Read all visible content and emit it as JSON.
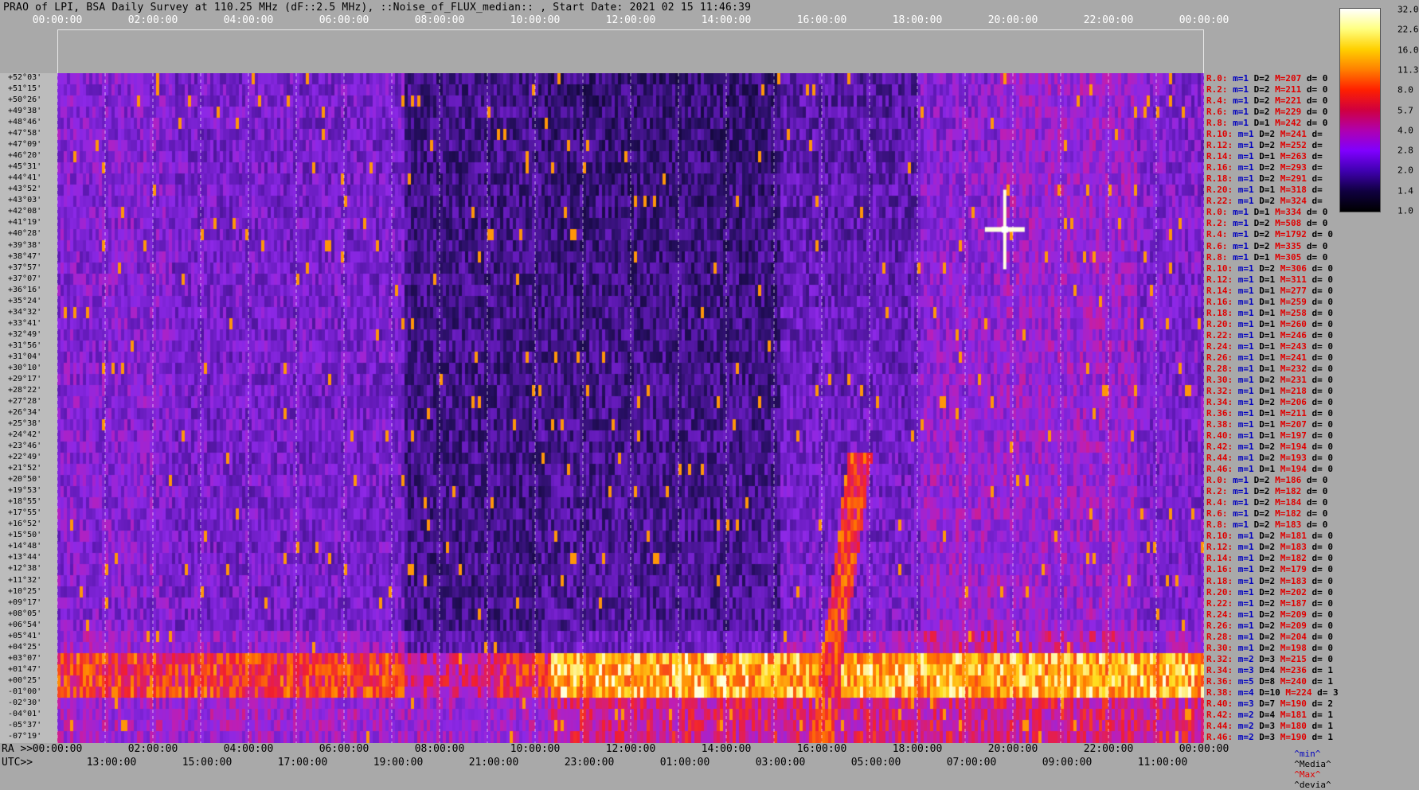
{
  "title": "PRAO of LPI, BSA Daily Survey at 110.25 MHz (dF::2.5 MHz), ::Noise_of_FLUX_median:: , Start Date: 2021 02 15 11:46:39",
  "top_ticks": [
    "00:00:00",
    "02:00:00",
    "04:00:00",
    "06:00:00",
    "08:00:00",
    "10:00:00",
    "12:00:00",
    "14:00:00",
    "16:00:00",
    "18:00:00",
    "20:00:00",
    "22:00:00",
    "00:00:00"
  ],
  "bottom_ra_prefix": "RA >>",
  "bottom_ra_ticks": [
    "00:00:00",
    "02:00:00",
    "04:00:00",
    "06:00:00",
    "08:00:00",
    "10:00:00",
    "12:00:00",
    "14:00:00",
    "16:00:00",
    "18:00:00",
    "20:00:00",
    "22:00:00",
    "00:00:00"
  ],
  "bottom_utc_prefix": "UTC>>",
  "bottom_utc_ticks": [
    "13:00:00",
    "15:00:00",
    "17:00:00",
    "19:00:00",
    "21:00:00",
    "23:00:00",
    "01:00:00",
    "03:00:00",
    "05:00:00",
    "07:00:00",
    "09:00:00",
    "11:00:00"
  ],
  "dec_labels": [
    "+52°03'",
    "+51°15'",
    "+50°26'",
    "+49°38'",
    "+48°46'",
    "+47°58'",
    "+47°09'",
    "+46°20'",
    "+45°31'",
    "+44°41'",
    "+43°52'",
    "+43°03'",
    "+42°08'",
    "+41°19'",
    "+40°28'",
    "+39°38'",
    "+38°47'",
    "+37°57'",
    "+37°07'",
    "+36°16'",
    "+35°24'",
    "+34°32'",
    "+33°41'",
    "+32°49'",
    "+31°56'",
    "+31°04'",
    "+30°10'",
    "+29°17'",
    "+28°22'",
    "+27°28'",
    "+26°34'",
    "+25°38'",
    "+24°42'",
    "+23°46'",
    "+22°49'",
    "+21°52'",
    "+20°50'",
    "+19°53'",
    "+18°55'",
    "+17°55'",
    "+16°52'",
    "+15°50'",
    "+14°48'",
    "+13°44'",
    "+12°38'",
    "+11°32'",
    "+10°25'",
    "+09°17'",
    "+08°05'",
    "+06°54'",
    "+05°41'",
    "+04°25'",
    "+03°07'",
    "+01°47'",
    "+00°25'",
    "-01°00'",
    "-02°30'",
    "-04°01'",
    "-05°37'",
    "-07°19'"
  ],
  "stats_rows": [
    {
      "r": "R.0:",
      "m": "m=1",
      "D": "D=2",
      "M": "M=207",
      "d": "d= 0"
    },
    {
      "r": "R.2:",
      "m": "m=1",
      "D": "D=2",
      "M": "M=211",
      "d": "d= 0"
    },
    {
      "r": "R.4:",
      "m": "m=1",
      "D": "D=2",
      "M": "M=221",
      "d": "d= 0"
    },
    {
      "r": "R.6:",
      "m": "m=1",
      "D": "D=2",
      "M": "M=229",
      "d": "d= 0"
    },
    {
      "r": "R.8:",
      "m": "m=1",
      "D": "D=1",
      "M": "M=242",
      "d": "d= 0"
    },
    {
      "r": "R.10:",
      "m": "m=1",
      "D": "D=2",
      "M": "M=241",
      "d": "d="
    },
    {
      "r": "R.12:",
      "m": "m=1",
      "D": "D=2",
      "M": "M=252",
      "d": "d="
    },
    {
      "r": "R.14:",
      "m": "m=1",
      "D": "D=1",
      "M": "M=263",
      "d": "d="
    },
    {
      "r": "R.16:",
      "m": "m=1",
      "D": "D=2",
      "M": "M=293",
      "d": "d="
    },
    {
      "r": "R.18:",
      "m": "m=1",
      "D": "D=2",
      "M": "M=291",
      "d": "d="
    },
    {
      "r": "R.20:",
      "m": "m=1",
      "D": "D=1",
      "M": "M=318",
      "d": "d="
    },
    {
      "r": "R.22:",
      "m": "m=1",
      "D": "D=2",
      "M": "M=324",
      "d": "d="
    },
    {
      "r": "R.0:",
      "m": "m=1",
      "D": "D=1",
      "M": "M=334",
      "d": "d= 0"
    },
    {
      "r": "R.2:",
      "m": "m=1",
      "D": "D=2",
      "M": "M=508",
      "d": "d= 0"
    },
    {
      "r": "R.4:",
      "m": "m=1",
      "D": "D=2",
      "M": "M=1792",
      "d": "d= 0"
    },
    {
      "r": "R.6:",
      "m": "m=1",
      "D": "D=2",
      "M": "M=335",
      "d": "d= 0"
    },
    {
      "r": "R.8:",
      "m": "m=1",
      "D": "D=1",
      "M": "M=305",
      "d": "d= 0"
    },
    {
      "r": "R.10:",
      "m": "m=1",
      "D": "D=2",
      "M": "M=306",
      "d": "d= 0"
    },
    {
      "r": "R.12:",
      "m": "m=1",
      "D": "D=1",
      "M": "M=311",
      "d": "d= 0"
    },
    {
      "r": "R.14:",
      "m": "m=1",
      "D": "D=1",
      "M": "M=277",
      "d": "d= 0"
    },
    {
      "r": "R.16:",
      "m": "m=1",
      "D": "D=1",
      "M": "M=259",
      "d": "d= 0"
    },
    {
      "r": "R.18:",
      "m": "m=1",
      "D": "D=1",
      "M": "M=258",
      "d": "d= 0"
    },
    {
      "r": "R.20:",
      "m": "m=1",
      "D": "D=1",
      "M": "M=260",
      "d": "d= 0"
    },
    {
      "r": "R.22:",
      "m": "m=1",
      "D": "D=1",
      "M": "M=246",
      "d": "d= 0"
    },
    {
      "r": "R.24:",
      "m": "m=1",
      "D": "D=1",
      "M": "M=243",
      "d": "d= 0"
    },
    {
      "r": "R.26:",
      "m": "m=1",
      "D": "D=1",
      "M": "M=241",
      "d": "d= 0"
    },
    {
      "r": "R.28:",
      "m": "m=1",
      "D": "D=1",
      "M": "M=232",
      "d": "d= 0"
    },
    {
      "r": "R.30:",
      "m": "m=1",
      "D": "D=2",
      "M": "M=231",
      "d": "d= 0"
    },
    {
      "r": "R.32:",
      "m": "m=1",
      "D": "D=1",
      "M": "M=218",
      "d": "d= 0"
    },
    {
      "r": "R.34:",
      "m": "m=1",
      "D": "D=2",
      "M": "M=206",
      "d": "d= 0"
    },
    {
      "r": "R.36:",
      "m": "m=1",
      "D": "D=1",
      "M": "M=211",
      "d": "d= 0"
    },
    {
      "r": "R.38:",
      "m": "m=1",
      "D": "D=1",
      "M": "M=207",
      "d": "d= 0"
    },
    {
      "r": "R.40:",
      "m": "m=1",
      "D": "D=1",
      "M": "M=197",
      "d": "d= 0"
    },
    {
      "r": "R.42:",
      "m": "m=1",
      "D": "D=2",
      "M": "M=194",
      "d": "d= 0"
    },
    {
      "r": "R.44:",
      "m": "m=1",
      "D": "D=2",
      "M": "M=193",
      "d": "d= 0"
    },
    {
      "r": "R.46:",
      "m": "m=1",
      "D": "D=1",
      "M": "M=194",
      "d": "d= 0"
    },
    {
      "r": "R.0:",
      "m": "m=1",
      "D": "D=2",
      "M": "M=186",
      "d": "d= 0"
    },
    {
      "r": "R.2:",
      "m": "m=1",
      "D": "D=2",
      "M": "M=182",
      "d": "d= 0"
    },
    {
      "r": "R.4:",
      "m": "m=1",
      "D": "D=2",
      "M": "M=184",
      "d": "d= 0"
    },
    {
      "r": "R.6:",
      "m": "m=1",
      "D": "D=2",
      "M": "M=182",
      "d": "d= 0"
    },
    {
      "r": "R.8:",
      "m": "m=1",
      "D": "D=2",
      "M": "M=183",
      "d": "d= 0"
    },
    {
      "r": "R.10:",
      "m": "m=1",
      "D": "D=2",
      "M": "M=181",
      "d": "d= 0"
    },
    {
      "r": "R.12:",
      "m": "m=1",
      "D": "D=2",
      "M": "M=183",
      "d": "d= 0"
    },
    {
      "r": "R.14:",
      "m": "m=1",
      "D": "D=2",
      "M": "M=182",
      "d": "d= 0"
    },
    {
      "r": "R.16:",
      "m": "m=1",
      "D": "D=2",
      "M": "M=179",
      "d": "d= 0"
    },
    {
      "r": "R.18:",
      "m": "m=1",
      "D": "D=2",
      "M": "M=183",
      "d": "d= 0"
    },
    {
      "r": "R.20:",
      "m": "m=1",
      "D": "D=2",
      "M": "M=202",
      "d": "d= 0"
    },
    {
      "r": "R.22:",
      "m": "m=1",
      "D": "D=2",
      "M": "M=187",
      "d": "d= 0"
    },
    {
      "r": "R.24:",
      "m": "m=1",
      "D": "D=2",
      "M": "M=209",
      "d": "d= 0"
    },
    {
      "r": "R.26:",
      "m": "m=1",
      "D": "D=2",
      "M": "M=209",
      "d": "d= 0"
    },
    {
      "r": "R.28:",
      "m": "m=1",
      "D": "D=2",
      "M": "M=204",
      "d": "d= 0"
    },
    {
      "r": "R.30:",
      "m": "m=1",
      "D": "D=2",
      "M": "M=198",
      "d": "d= 0"
    },
    {
      "r": "R.32:",
      "m": "m=2",
      "D": "D=3",
      "M": "M=215",
      "d": "d= 0"
    },
    {
      "r": "R.34:",
      "m": "m=3",
      "D": "D=4",
      "M": "M=236",
      "d": "d= 1"
    },
    {
      "r": "R.36:",
      "m": "m=5",
      "D": "D=8",
      "M": "M=240",
      "d": "d= 1"
    },
    {
      "r": "R.38:",
      "m": "m=4",
      "D": "D=10",
      "M": "M=224",
      "d": "d= 3"
    },
    {
      "r": "R.40:",
      "m": "m=3",
      "D": "D=7",
      "M": "M=190",
      "d": "d= 2"
    },
    {
      "r": "R.42:",
      "m": "m=2",
      "D": "D=4",
      "M": "M=181",
      "d": "d= 1"
    },
    {
      "r": "R.44:",
      "m": "m=2",
      "D": "D=3",
      "M": "M=180",
      "d": "d= 1"
    },
    {
      "r": "R.46:",
      "m": "m=2",
      "D": "D=3",
      "M": "M=190",
      "d": "d= 1"
    }
  ],
  "legend": {
    "min": "^min^",
    "media": "^Media^",
    "max": "^Max^",
    "devia": "^devia^"
  },
  "chart_data": {
    "type": "heatmap",
    "title": "PRAO of LPI, BSA Daily Survey at 110.25 MHz (dF::2.5 MHz), ::Noise_of_FLUX_median:: , Start Date: 2021 02 15 11:46:39",
    "x_axis_top": {
      "label": "",
      "ticks": [
        "00:00:00",
        "02:00:00",
        "04:00:00",
        "06:00:00",
        "08:00:00",
        "10:00:00",
        "12:00:00",
        "14:00:00",
        "16:00:00",
        "18:00:00",
        "20:00:00",
        "22:00:00",
        "00:00:00"
      ]
    },
    "x_axis_bottom_ra": {
      "label": "RA >>",
      "ticks": [
        "00:00:00",
        "02:00:00",
        "04:00:00",
        "06:00:00",
        "08:00:00",
        "10:00:00",
        "12:00:00",
        "14:00:00",
        "16:00:00",
        "18:00:00",
        "20:00:00",
        "22:00:00",
        "00:00:00"
      ]
    },
    "x_axis_bottom_utc": {
      "label": "UTC>>",
      "ticks": [
        "13:00:00",
        "15:00:00",
        "17:00:00",
        "19:00:00",
        "21:00:00",
        "23:00:00",
        "01:00:00",
        "03:00:00",
        "05:00:00",
        "07:00:00",
        "09:00:00",
        "11:00:00"
      ]
    },
    "y_axis": {
      "label": "",
      "range": [
        "+52°03'",
        "-07°19'"
      ],
      "rows": 60
    },
    "colorbar": {
      "ticks": [
        32.0,
        22.6,
        16.0,
        11.3,
        8.0,
        5.7,
        4.0,
        2.8,
        2.0,
        1.4,
        1.0
      ],
      "scale": "log2",
      "colormap": [
        "#ffffff",
        "#ffff80",
        "#ffd000",
        "#ff8000",
        "#ff2000",
        "#d00040",
        "#b000b0",
        "#8000ff",
        "#4000b0",
        "#100040",
        "#000000"
      ]
    },
    "features": [
      {
        "type": "band",
        "dec_range": [
          "+01°47'",
          "-02°30'"
        ],
        "ra_range": [
          "10:40:00",
          "00:00:00"
        ],
        "level": 22.6
      },
      {
        "type": "band",
        "dec_range": [
          "+01°47'",
          "-02°30'"
        ],
        "ra_range": [
          "00:00:00",
          "08:00:00"
        ],
        "level": 8.0
      },
      {
        "type": "point_source",
        "ra": "19:50:00",
        "dec": "+40°40'",
        "level": 32.0
      },
      {
        "type": "quiet_region",
        "ra_range": [
          "08:30:00",
          "10:40:00"
        ],
        "level": 1.4
      }
    ]
  }
}
